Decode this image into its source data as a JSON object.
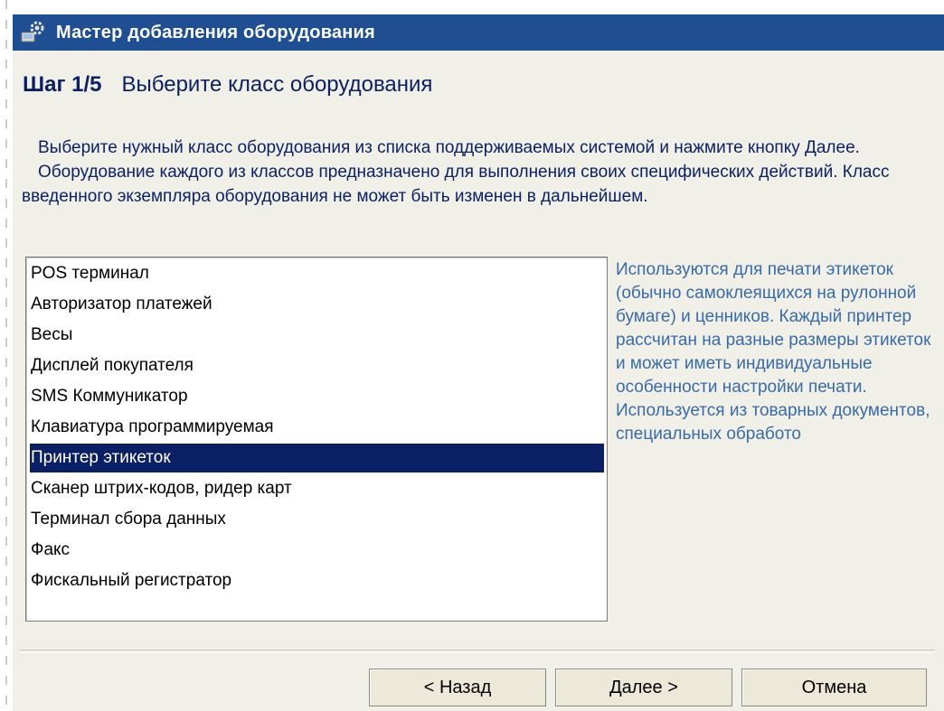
{
  "window": {
    "title": "Мастер добавления оборудования"
  },
  "step": {
    "number": "Шаг 1/5",
    "title": "Выберите класс оборудования"
  },
  "description": [
    "Выберите нужный класс оборудования из списка поддерживаемых системой и нажмите кнопку Далее.",
    "Оборудование каждого из классов предназначено для выполнения своих специфических действий. Класс введенного экземпляра оборудования не может быть изменен в дальнейшем."
  ],
  "list": {
    "items": [
      "POS терминал",
      "Авторизатор платежей",
      "Весы",
      "Дисплей покупателя",
      "SMS Коммуникатор",
      "Клавиатура программируемая",
      "Принтер этикеток",
      "Сканер штрих-кодов, ридер карт",
      "Терминал сбора данных",
      "Факс",
      "Фискальный регистратор"
    ],
    "selected_index": 6
  },
  "info_text": "Используются для печати этикеток (обычно самоклеящихся на рулонной бумаге) и ценников. Каждый принтер рассчитан на разные размеры этикеток и может иметь индивидуальные особенности настройки печати. Используется из товарных документов, специальных обработо",
  "buttons": {
    "back": "< Назад",
    "next": "Далее >",
    "cancel": "Отмена"
  },
  "colors": {
    "titlebar": "#1f4e93",
    "selection": "#0b1f64",
    "text_dark_blue": "#0b1f64",
    "info_blue": "#3a6aa7",
    "panel_bg": "#f0f0e8"
  },
  "icons": {
    "title": "equipment-wizard-icon"
  }
}
